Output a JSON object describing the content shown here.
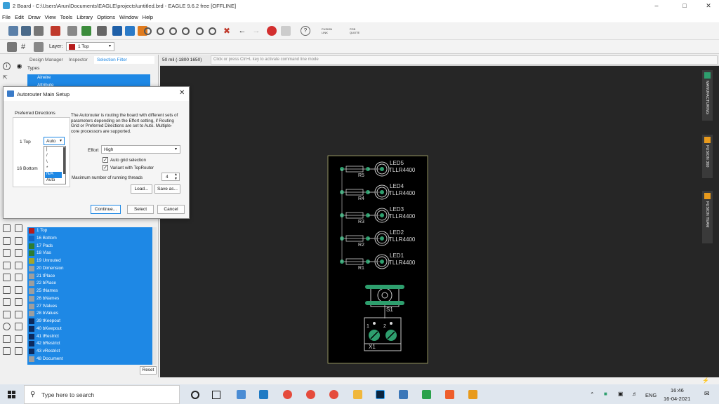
{
  "window": {
    "title": "2 Board - C:\\Users\\Arun\\Documents\\EAGLE\\projects\\untitled.brd - EAGLE 9.6.2 free [OFFLINE]"
  },
  "menu": [
    "File",
    "Edit",
    "Draw",
    "View",
    "Tools",
    "Library",
    "Options",
    "Window",
    "Help"
  ],
  "toolbar": {
    "fusion_link": "FUSION LINK",
    "pcb_quote": "PCB QUOTE"
  },
  "layer_selector": {
    "label": "Layer:",
    "value": "1 Top"
  },
  "panel_tabs": [
    "Design Manager",
    "Inspector",
    "Selection Filter"
  ],
  "types": {
    "header": "Types",
    "items": [
      "Airwire",
      "Attribute"
    ]
  },
  "layers": [
    {
      "name": "1 Top",
      "color": "#b71c1c"
    },
    {
      "name": "16 Bottom",
      "color": "#1565c0"
    },
    {
      "name": "17 Pads",
      "color": "#2e7d32"
    },
    {
      "name": "18 Vias",
      "color": "#2e7d32"
    },
    {
      "name": "19 Unrouted",
      "color": "#a5a52a"
    },
    {
      "name": "20 Dimension",
      "color": "#9e9e9e"
    },
    {
      "name": "21 tPlace",
      "color": "#9e9e9e"
    },
    {
      "name": "22 bPlace",
      "color": "#9e9e9e"
    },
    {
      "name": "25 tNames",
      "color": "#9e9e9e"
    },
    {
      "name": "26 bNames",
      "color": "#9e9e9e"
    },
    {
      "name": "27 tValues",
      "color": "#9e9e9e"
    },
    {
      "name": "28 bValues",
      "color": "#9e9e9e"
    },
    {
      "name": "39 tKeepout",
      "color": "#0d2a5c"
    },
    {
      "name": "40 bKeepout",
      "color": "#0d2a5c"
    },
    {
      "name": "41 tRestrict",
      "color": "#0d2a5c"
    },
    {
      "name": "42 bRestrict",
      "color": "#0d2a5c"
    },
    {
      "name": "43 vRestrict",
      "color": "#0d2a5c"
    },
    {
      "name": "48 Document",
      "color": "#9e9e9e"
    }
  ],
  "reset_label": "Reset",
  "coord": "50 mil (-1800 1650)",
  "command_placeholder": "Click or press Ctrl+L key to activate command line mode",
  "dialog": {
    "title": "Autorouter Main Setup",
    "group_label": "Preferred Directions",
    "top_label": "1  Top",
    "bottom_label": "16  Bottom",
    "top_select": "Auto",
    "dropdown_options": [
      "|",
      "/",
      "\\",
      "*",
      "N/A",
      "Auto"
    ],
    "description": "The Autorouter is routing the board with different sets of parameters depending on the Effort setting, if Routing Grid or Preferred Directions are set to Auto. Multiple-core processors are supported.",
    "effort_label": "Effort",
    "effort_value": "High",
    "auto_grid": "Auto grid selection",
    "variant": "Variant with TopRouter",
    "threads_label": "Maximum number of running threads",
    "threads_value": "4",
    "load": "Load...",
    "save_as": "Save as...",
    "continue": "Continue...",
    "select": "Select",
    "cancel": "Cancel"
  },
  "pcb": {
    "leds": [
      {
        "name": "LED5",
        "value": "TLLR4400",
        "res": "R5"
      },
      {
        "name": "LED4",
        "value": "TLLR4400",
        "res": "R4"
      },
      {
        "name": "LED3",
        "value": "TLLR4400",
        "res": "R3"
      },
      {
        "name": "LED2",
        "value": "TLLR4400",
        "res": "R2"
      },
      {
        "name": "LED1",
        "value": "TLLR4400",
        "res": "R1"
      }
    ],
    "switch": "S1",
    "connector": "X1",
    "pin1": "1",
    "pin2": "2"
  },
  "side_tabs": [
    "MANUFACTURING",
    "FUSION 360",
    "FUSION TEAM"
  ],
  "taskbar": {
    "search": "Type here to search",
    "lang": "ENG",
    "time": "16:46",
    "date": "16-04-2021"
  }
}
